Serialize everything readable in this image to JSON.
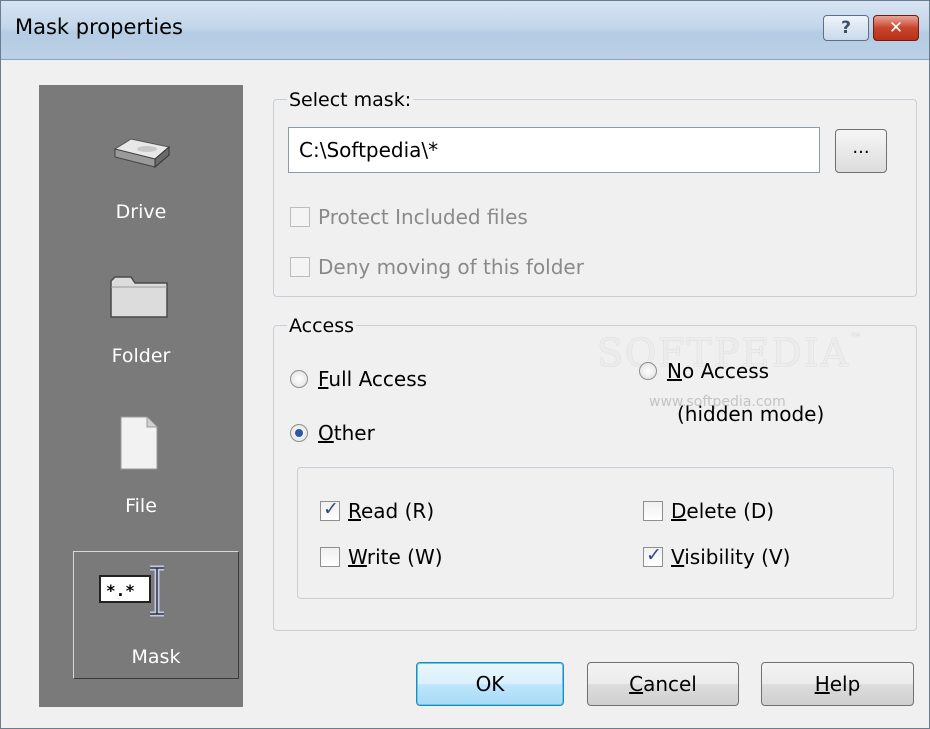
{
  "window": {
    "title": "Mask properties",
    "help_button": "?",
    "close_button": "✕"
  },
  "sidebar": {
    "items": [
      {
        "label": "Drive",
        "icon": "drive-icon"
      },
      {
        "label": "Folder",
        "icon": "folder-icon"
      },
      {
        "label": "File",
        "icon": "file-icon"
      },
      {
        "label": "Mask",
        "icon": "mask-icon",
        "selected": true
      }
    ]
  },
  "select_mask": {
    "group_title": "Select mask:",
    "value": "C:\\Softpedia\\*",
    "browse_label": "...",
    "protect_included": {
      "label": "Protect Included files",
      "checked": false,
      "enabled": false
    },
    "deny_moving": {
      "label": "Deny moving of this folder",
      "checked": false,
      "enabled": false
    }
  },
  "access": {
    "group_title": "Access",
    "full_access": {
      "label_u": "F",
      "label_rest": "ull Access",
      "selected": false
    },
    "no_access": {
      "label_u": "N",
      "label_rest": "o Access",
      "line2": "(hidden mode)",
      "selected": false
    },
    "other": {
      "label_u": "O",
      "label_rest": "ther",
      "selected": true
    },
    "permissions": {
      "read": {
        "label_u": "R",
        "label_rest": "ead (R)",
        "checked": true
      },
      "write": {
        "label_u": "W",
        "label_rest": "rite (W)",
        "checked": false
      },
      "delete": {
        "label_u": "D",
        "label_rest": "elete (D)",
        "checked": false
      },
      "visibility": {
        "label_u": "V",
        "label_rest": "isibility (V)",
        "checked": true
      }
    }
  },
  "buttons": {
    "ok": "OK",
    "cancel_u": "C",
    "cancel_rest": "ancel",
    "help_u": "H",
    "help_rest": "elp"
  },
  "watermark": {
    "text": "SOFTPEDIA",
    "tm": "™",
    "sub": "www.softpedia.com"
  },
  "colors": {
    "sidebar": "#7a7a7a",
    "titlebar": "#c3d6ea",
    "close": "#c9442c",
    "radio_dot": "#2b57a3"
  }
}
